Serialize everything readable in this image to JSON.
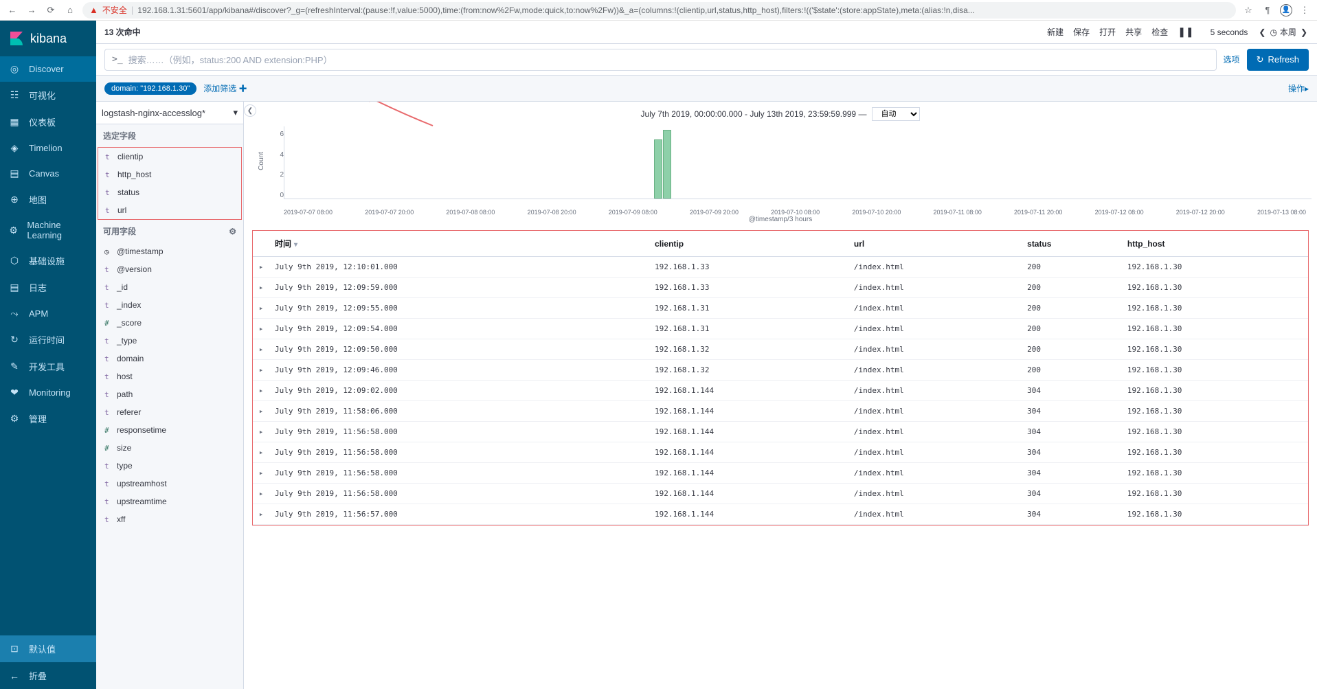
{
  "browser": {
    "insecure": "不安全",
    "url": "192.168.1.31:5601/app/kibana#/discover?_g=(refreshInterval:(pause:!f,value:5000),time:(from:now%2Fw,mode:quick,to:now%2Fw))&_a=(columns:!(clientip,url,status,http_host),filters:!(('$state':(store:appState),meta:(alias:!n,disa..."
  },
  "logo": "kibana",
  "nav": [
    {
      "icon": "◎",
      "label": "Discover",
      "active": true
    },
    {
      "icon": "☷",
      "label": "可视化"
    },
    {
      "icon": "▦",
      "label": "仪表板"
    },
    {
      "icon": "◈",
      "label": "Timelion"
    },
    {
      "icon": "▤",
      "label": "Canvas"
    },
    {
      "icon": "⊕",
      "label": "地图"
    },
    {
      "icon": "⚙",
      "label": "Machine Learning"
    },
    {
      "icon": "⬡",
      "label": "基础设施"
    },
    {
      "icon": "▤",
      "label": "日志"
    },
    {
      "icon": "⤳",
      "label": "APM"
    },
    {
      "icon": "↻",
      "label": "运行时间"
    },
    {
      "icon": "✎",
      "label": "开发工具"
    },
    {
      "icon": "❤",
      "label": "Monitoring"
    },
    {
      "icon": "⚙",
      "label": "管理"
    }
  ],
  "nav_default": {
    "icon": "⊡",
    "label": "默认值"
  },
  "nav_collapse": {
    "icon": "←",
    "label": "折叠"
  },
  "topbar": {
    "hits": "13 次命中",
    "menu": [
      "新建",
      "保存",
      "打开",
      "共享",
      "检查"
    ],
    "pause": "❚❚",
    "interval": "5 seconds",
    "time_label": "本周"
  },
  "query": {
    "prompt": ">_",
    "placeholder": "搜索……（例如，status:200 AND extension:PHP）",
    "options": "选项",
    "refresh": "Refresh"
  },
  "filters": {
    "pill": "domain: \"192.168.1.30\"",
    "add": "添加筛选 ✚",
    "ops": "操作▸"
  },
  "index_pattern": "logstash-nginx-accesslog*",
  "fields": {
    "selected_header": "选定字段",
    "selected": [
      {
        "t": "t",
        "name": "clientip"
      },
      {
        "t": "t",
        "name": "http_host"
      },
      {
        "t": "t",
        "name": "status"
      },
      {
        "t": "t",
        "name": "url"
      }
    ],
    "available_header": "可用字段",
    "available": [
      {
        "t": "◷",
        "cls": "clock",
        "name": "@timestamp"
      },
      {
        "t": "t",
        "name": "@version"
      },
      {
        "t": "t",
        "name": "_id"
      },
      {
        "t": "t",
        "name": "_index"
      },
      {
        "t": "#",
        "cls": "num",
        "name": "_score"
      },
      {
        "t": "t",
        "name": "_type"
      },
      {
        "t": "t",
        "name": "domain"
      },
      {
        "t": "t",
        "name": "host"
      },
      {
        "t": "t",
        "name": "path"
      },
      {
        "t": "t",
        "name": "referer"
      },
      {
        "t": "#",
        "cls": "num",
        "name": "responsetime"
      },
      {
        "t": "#",
        "cls": "num",
        "name": "size"
      },
      {
        "t": "t",
        "name": "type"
      },
      {
        "t": "t",
        "name": "upstreamhost"
      },
      {
        "t": "t",
        "name": "upstreamtime"
      },
      {
        "t": "t",
        "name": "xff"
      }
    ]
  },
  "time_range": "July 7th 2019, 00:00:00.000 - July 13th 2019, 23:59:59.999 —",
  "auto": "自动",
  "chart_data": {
    "type": "bar",
    "ylabel": "Count",
    "xlabel": "@timestamp/3 hours",
    "yticks": [
      "6",
      "4",
      "2",
      "0"
    ],
    "xticks": [
      "2019-07-07 08:00",
      "2019-07-07 20:00",
      "2019-07-08 08:00",
      "2019-07-08 20:00",
      "2019-07-09 08:00",
      "2019-07-09 20:00",
      "2019-07-10 08:00",
      "2019-07-10 20:00",
      "2019-07-11 08:00",
      "2019-07-11 20:00",
      "2019-07-12 08:00",
      "2019-07-12 20:00",
      "2019-07-13 08:00"
    ],
    "bars": [
      {
        "pos": 36,
        "h": 6
      },
      {
        "pos": 38,
        "h": 7
      }
    ],
    "ymax": 7
  },
  "table": {
    "columns": [
      "时间",
      "clientip",
      "url",
      "status",
      "http_host"
    ],
    "rows": [
      [
        "July 9th 2019, 12:10:01.000",
        "192.168.1.33",
        "/index.html",
        "200",
        "192.168.1.30"
      ],
      [
        "July 9th 2019, 12:09:59.000",
        "192.168.1.33",
        "/index.html",
        "200",
        "192.168.1.30"
      ],
      [
        "July 9th 2019, 12:09:55.000",
        "192.168.1.31",
        "/index.html",
        "200",
        "192.168.1.30"
      ],
      [
        "July 9th 2019, 12:09:54.000",
        "192.168.1.31",
        "/index.html",
        "200",
        "192.168.1.30"
      ],
      [
        "July 9th 2019, 12:09:50.000",
        "192.168.1.32",
        "/index.html",
        "200",
        "192.168.1.30"
      ],
      [
        "July 9th 2019, 12:09:46.000",
        "192.168.1.32",
        "/index.html",
        "200",
        "192.168.1.30"
      ],
      [
        "July 9th 2019, 12:09:02.000",
        "192.168.1.144",
        "/index.html",
        "304",
        "192.168.1.30"
      ],
      [
        "July 9th 2019, 11:58:06.000",
        "192.168.1.144",
        "/index.html",
        "304",
        "192.168.1.30"
      ],
      [
        "July 9th 2019, 11:56:58.000",
        "192.168.1.144",
        "/index.html",
        "304",
        "192.168.1.30"
      ],
      [
        "July 9th 2019, 11:56:58.000",
        "192.168.1.144",
        "/index.html",
        "304",
        "192.168.1.30"
      ],
      [
        "July 9th 2019, 11:56:58.000",
        "192.168.1.144",
        "/index.html",
        "304",
        "192.168.1.30"
      ],
      [
        "July 9th 2019, 11:56:58.000",
        "192.168.1.144",
        "/index.html",
        "304",
        "192.168.1.30"
      ],
      [
        "July 9th 2019, 11:56:57.000",
        "192.168.1.144",
        "/index.html",
        "304",
        "192.168.1.30"
      ]
    ]
  }
}
